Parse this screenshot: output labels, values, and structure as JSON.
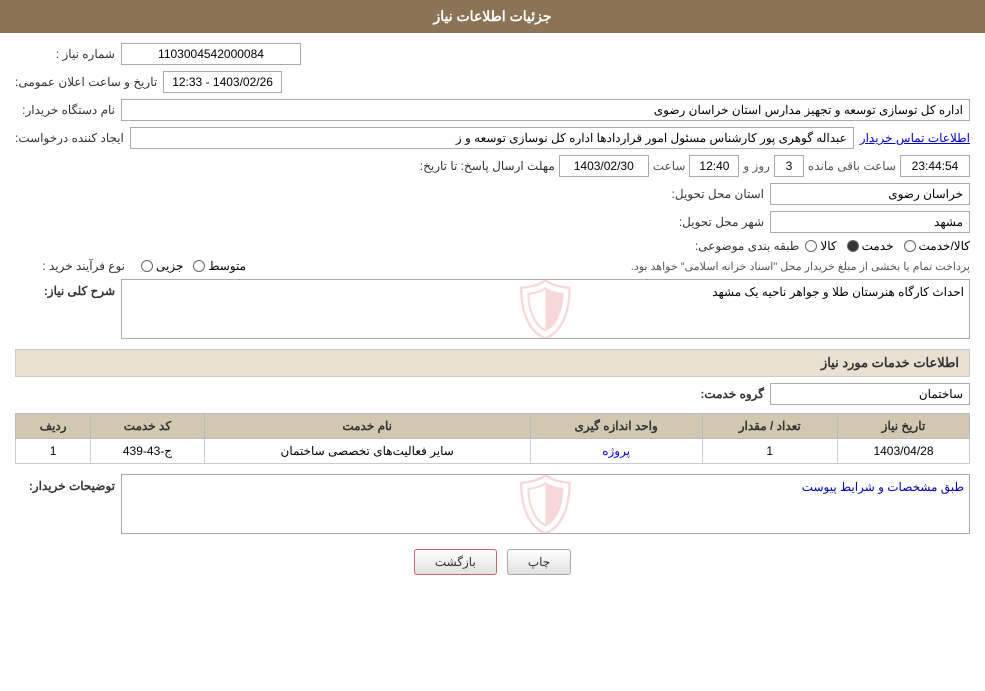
{
  "page": {
    "title": "جزئیات اطلاعات نیاز",
    "header_color": "#8B7355"
  },
  "fields": {
    "shmare_niaz_label": "شماره نیاز :",
    "shmare_niaz_value": "1103004542000084",
    "tarikh_label": "تاریخ و ساعت اعلان عمومی:",
    "tarikh_value": "1403/02/26 - 12:33",
    "nam_dastgah_label": "نام دستگاه خریدار:",
    "nam_dastgah_value": "اداره کل توسازی  توسعه و تجهیز مدارس استان خراسان رضوی",
    "ijad_label": "ایجاد کننده درخواست:",
    "ijad_value": "عبداله گوهری پور کارشناس مسئول امور قراردادها  اداره کل نوسازی  توسعه و ز",
    "ijad_link": "اطلاعات تماس خریدار",
    "mohlat_label": "مهلت ارسال پاسخ: تا تاریخ:",
    "mohlat_date": "1403/02/30",
    "mohlat_saat_label": "ساعت",
    "mohlat_saat": "12:40",
    "mohlat_rooz_label": "روز و",
    "mohlat_rooz": "3",
    "mohlat_countdown_label": "ساعت باقی مانده",
    "mohlat_countdown": "23:44:54",
    "ostan_label": "استان محل تحویل:",
    "ostan_value": "خراسان رضوی",
    "shahr_label": "شهر محل تحویل:",
    "shahr_value": "مشهد",
    "tabaqe_label": "طبقه بندی موضوعی:",
    "tabaqe_kala": "کالا",
    "tabaqe_khedmat": "خدمت",
    "tabaqe_kala_khedmat": "کالا/خدمت",
    "tabaqe_selected": "khedmat",
    "nooe_label": "نوع فرآیند خرید :",
    "nooe_jazii": "جزیی",
    "nooe_motevaset": "متوسط",
    "nooe_description": "پرداخت تمام یا بخشی از مبلغ خریدار محل \"اسناد خزانه اسلامی\" خواهد بود.",
    "sharh_label": "شرح کلی نیاز:",
    "sharh_value": "احداث کارگاه هنرستان طلا و جواهر ناحیه یک مشهد",
    "service_section_title": "اطلاعات خدمات مورد نیاز",
    "goroh_label": "گروه خدمت:",
    "goroh_value": "ساختمان",
    "table": {
      "col_radif": "ردیف",
      "col_code": "کد خدمت",
      "col_name": "نام خدمت",
      "col_vahad": "واحد اندازه گیری",
      "col_tedad": "تعداد / مقدار",
      "col_tarikh": "تاریخ نیاز",
      "rows": [
        {
          "radif": "1",
          "code": "ج-43-439",
          "name": "سایر فعالیت‌های تخصصی ساختمان",
          "vahad": "پروژه",
          "tedad": "1",
          "tarikh": "1403/04/28"
        }
      ]
    },
    "tosif_label": "توضیحات خریدار:",
    "tosif_value": "طبق مشخصات و شرایط پیوست",
    "btn_chap": "چاپ",
    "btn_bazgasht": "بازگشت"
  }
}
